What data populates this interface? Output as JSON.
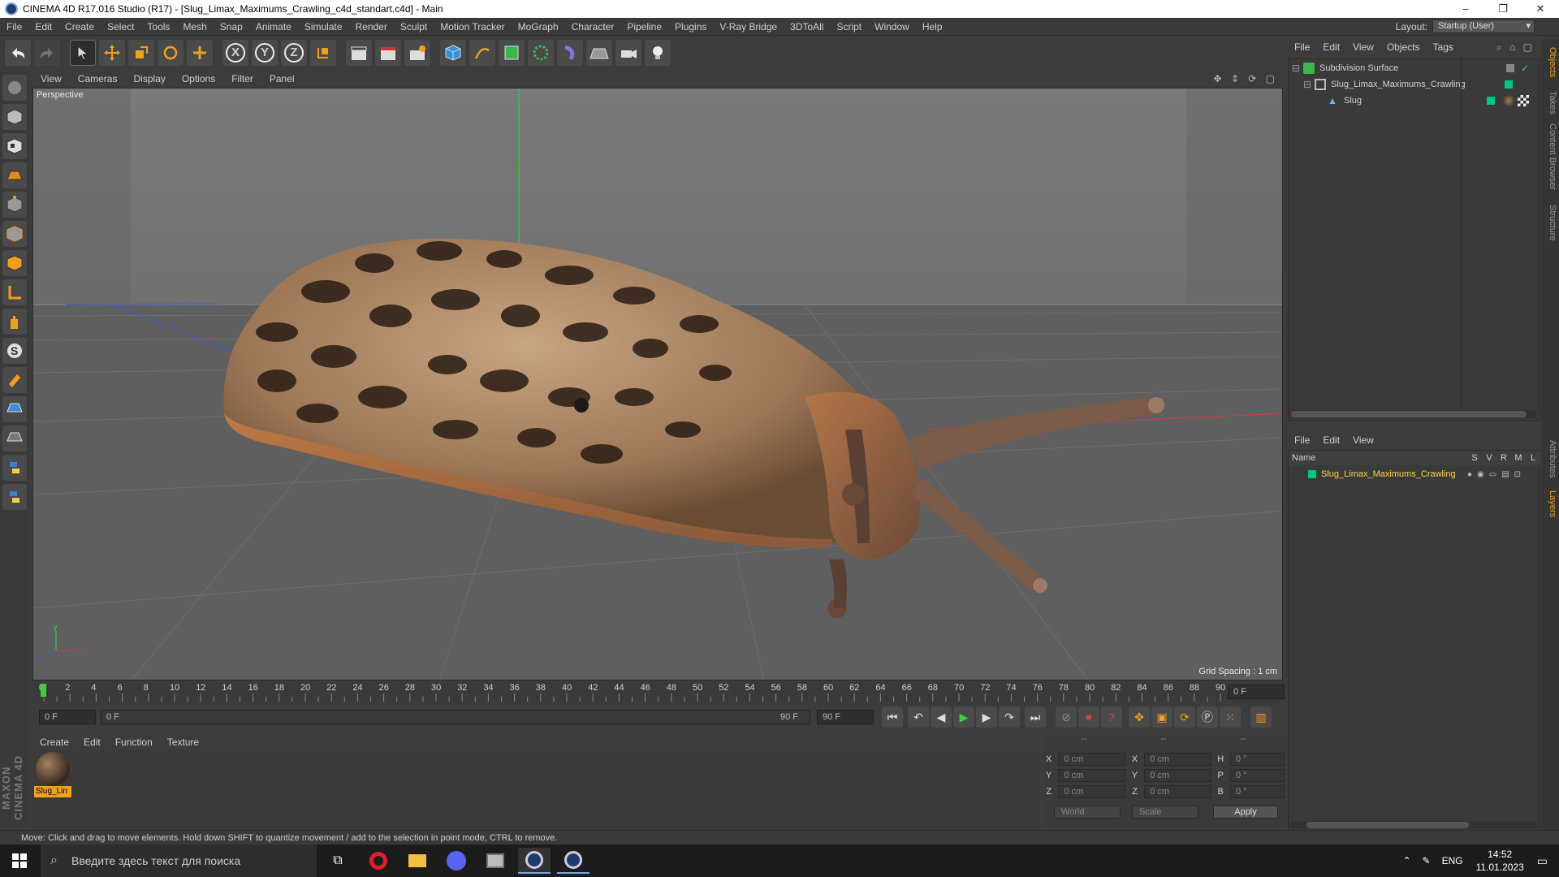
{
  "window": {
    "title": "CINEMA 4D R17.016 Studio (R17) - [Slug_Limax_Maximums_Crawling_c4d_standart.c4d] - Main",
    "minimize": "–",
    "restore": "❐",
    "close": "✕"
  },
  "menubar": {
    "items": [
      "File",
      "Edit",
      "Create",
      "Select",
      "Tools",
      "Mesh",
      "Snap",
      "Animate",
      "Simulate",
      "Render",
      "Sculpt",
      "Motion Tracker",
      "MoGraph",
      "Character",
      "Pipeline",
      "Plugins",
      "V-Ray Bridge",
      "3DToAll",
      "Script",
      "Window",
      "Help"
    ],
    "layout_label": "Layout:",
    "layout_value": "Startup (User)"
  },
  "toolbar": {
    "axis_x": "X",
    "axis_y": "Y",
    "axis_z": "Z"
  },
  "viewport": {
    "menu": [
      "View",
      "Cameras",
      "Display",
      "Options",
      "Filter",
      "Panel"
    ],
    "label": "Perspective",
    "grid_spacing": "Grid Spacing : 1 cm"
  },
  "timeline": {
    "ticks": [
      "0",
      "2",
      "4",
      "6",
      "8",
      "10",
      "12",
      "14",
      "16",
      "18",
      "20",
      "22",
      "24",
      "26",
      "28",
      "30",
      "32",
      "34",
      "36",
      "38",
      "40",
      "42",
      "44",
      "46",
      "48",
      "50",
      "52",
      "54",
      "56",
      "58",
      "60",
      "62",
      "64",
      "66",
      "68",
      "70",
      "72",
      "74",
      "76",
      "78",
      "80",
      "82",
      "84",
      "86",
      "88",
      "90"
    ],
    "current_frame": "0 F",
    "start_field": "0 F",
    "range_start": "0 F",
    "range_end": "90 F",
    "end_field": "90 F"
  },
  "material_manager": {
    "menu": [
      "Create",
      "Edit",
      "Function",
      "Texture"
    ],
    "material_name": "Slug_Lin"
  },
  "coordinates": {
    "headers": [
      "--",
      "--",
      "--"
    ],
    "rows": [
      {
        "a": "X",
        "v1": "0 cm",
        "b": "X",
        "v2": "0 cm",
        "c": "H",
        "v3": "0 °"
      },
      {
        "a": "Y",
        "v1": "0 cm",
        "b": "Y",
        "v2": "0 cm",
        "c": "P",
        "v3": "0 °"
      },
      {
        "a": "Z",
        "v1": "0 cm",
        "b": "Z",
        "v2": "0 cm",
        "c": "B",
        "v3": "0 °"
      }
    ],
    "mode1": "World",
    "mode2": "Scale",
    "apply": "Apply"
  },
  "object_manager": {
    "menu": [
      "File",
      "Edit",
      "View",
      "Objects",
      "Tags"
    ],
    "objects": [
      "Subdivision Surface",
      "Slug_Limax_Maximums_Crawling",
      "Slug"
    ]
  },
  "layer_manager": {
    "menu": [
      "File",
      "Edit",
      "View"
    ],
    "col_name": "Name",
    "cols": [
      "S",
      "V",
      "R",
      "M",
      "L"
    ],
    "layer": "Slug_Limax_Maximums_Crawling"
  },
  "side_tabs": [
    "Objects",
    "Takes",
    "Content Browser",
    "Structure",
    "Attributes",
    "Layers"
  ],
  "status": "Move: Click and drag to move elements. Hold down SHIFT to quantize movement / add to the selection in point mode, CTRL to remove.",
  "brand": "MAXON CINEMA 4D",
  "taskbar": {
    "search_placeholder": "Введите здесь текст для поиска",
    "lang": "ENG",
    "time": "14:52",
    "date": "11.01.2023"
  },
  "colors": {
    "accent_layer": "#00c878",
    "layer_text": "#ffd24a",
    "x_axis": "#d23c3c",
    "y_axis": "#3cd23c",
    "z_axis": "#3c5ad2"
  }
}
